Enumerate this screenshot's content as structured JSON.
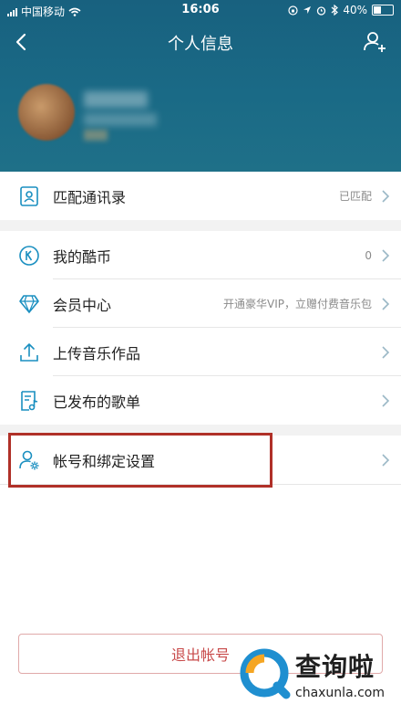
{
  "status_bar": {
    "carrier": "中国移动",
    "time": "16:06",
    "battery": "40%"
  },
  "header": {
    "title": "个人信息"
  },
  "groups": [
    {
      "items": [
        {
          "label": "匹配通讯录",
          "value": "已匹配",
          "icon": "contacts-icon"
        }
      ]
    },
    {
      "items": [
        {
          "label": "我的酷币",
          "value": "0",
          "icon": "coin-icon"
        },
        {
          "label": "会员中心",
          "value": "开通豪华VIP，立赠付费音乐包",
          "icon": "diamond-icon"
        },
        {
          "label": "上传音乐作品",
          "value": "",
          "icon": "upload-icon"
        },
        {
          "label": "已发布的歌单",
          "value": "",
          "icon": "playlist-icon"
        }
      ]
    },
    {
      "items": [
        {
          "label": "帐号和绑定设置",
          "value": "",
          "icon": "account-settings-icon"
        }
      ]
    }
  ],
  "logout": {
    "label": "退出帐号"
  },
  "watermark": {
    "cn": "查询啦",
    "en": "chaxunla.com"
  },
  "colors": {
    "header_bg": "#1a6a86",
    "icon_accent": "#1a8fc0",
    "highlight_border": "#b03028",
    "logout_text": "#c84a4a"
  }
}
